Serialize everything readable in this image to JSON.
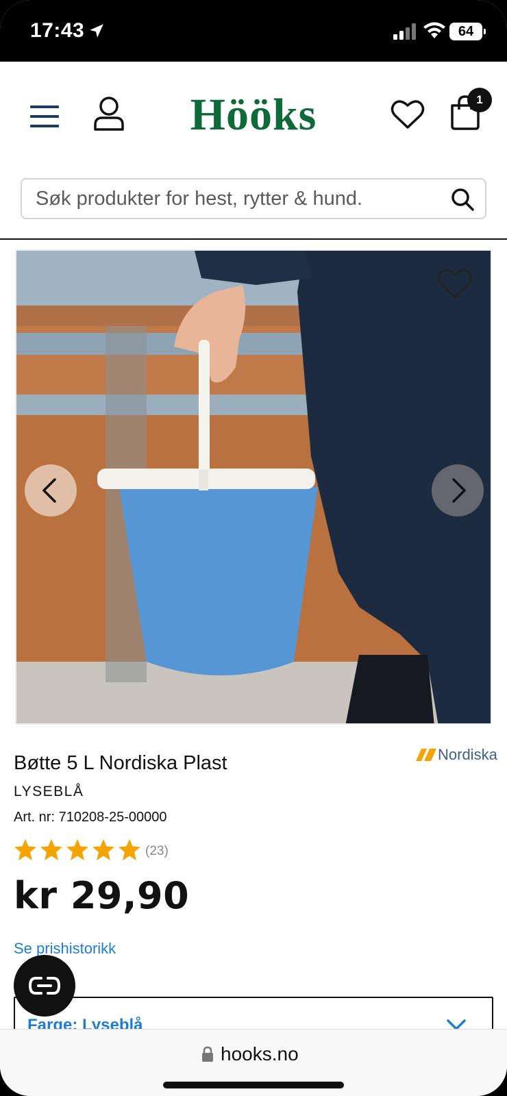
{
  "status_bar": {
    "time": "17:43",
    "battery": "64"
  },
  "header": {
    "logo": "Hööks",
    "cart_count": "1",
    "search_placeholder": "Søk produkter for hest, rytter & hund."
  },
  "product": {
    "brand": "Nordiska",
    "title": "Bøtte 5 L Nordiska Plast",
    "variant": "LYSEBLÅ",
    "article_number": "Art. nr: 710208-25-00000",
    "rating_stars": 5,
    "rating_count": "(23)",
    "price": "kr 29,90",
    "price_history_link": "Se prishistorikk",
    "color_select_label": "Farge: Lyseblå"
  },
  "browser": {
    "url": "hooks.no"
  },
  "colors": {
    "brand_green": "#0f6a3a",
    "link_blue": "#1f7ecb",
    "star_orange": "#f5a300"
  }
}
